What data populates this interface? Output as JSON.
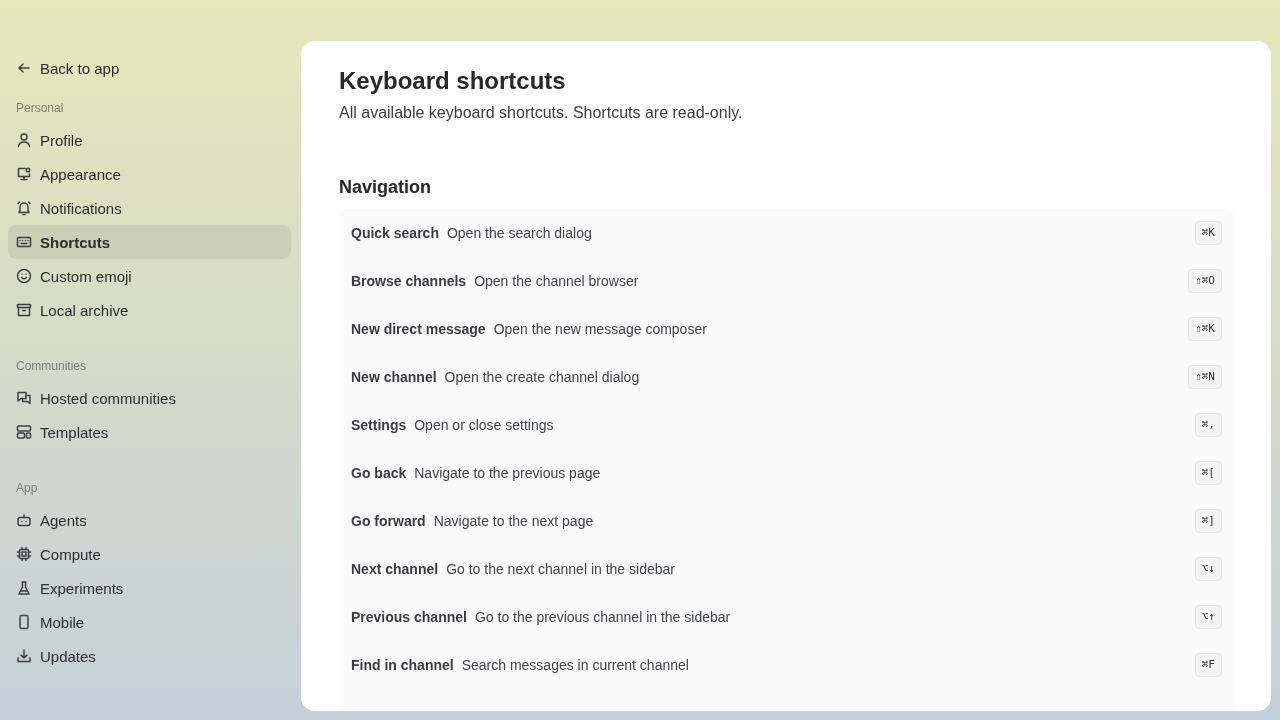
{
  "sidebar": {
    "back_link": "Back to app",
    "sections": [
      {
        "label": "Personal",
        "items": [
          {
            "label": "Profile",
            "selected": false
          },
          {
            "label": "Appearance",
            "selected": false
          },
          {
            "label": "Notifications",
            "selected": false
          },
          {
            "label": "Shortcuts",
            "selected": true
          },
          {
            "label": "Custom emoji",
            "selected": false
          },
          {
            "label": "Local archive",
            "selected": false
          }
        ]
      },
      {
        "label": "Communities",
        "items": [
          {
            "label": "Hosted communities",
            "selected": false
          },
          {
            "label": "Templates",
            "selected": false
          }
        ]
      },
      {
        "label": "App",
        "items": [
          {
            "label": "Agents",
            "selected": false
          },
          {
            "label": "Compute",
            "selected": false
          },
          {
            "label": "Experiments",
            "selected": false
          },
          {
            "label": "Mobile",
            "selected": false
          },
          {
            "label": "Updates",
            "selected": false
          }
        ]
      }
    ]
  },
  "page": {
    "title": "Keyboard shortcuts",
    "subtitle": "All available keyboard shortcuts. Shortcuts are read-only.",
    "groups": [
      {
        "heading": "Navigation",
        "shortcuts": [
          {
            "name": "Quick search",
            "description": "Open the search dialog",
            "keys": "⌘K"
          },
          {
            "name": "Browse channels",
            "description": "Open the channel browser",
            "keys": "⇧⌘O"
          },
          {
            "name": "New direct message",
            "description": "Open the new message composer",
            "keys": "⇧⌘K"
          },
          {
            "name": "New channel",
            "description": "Open the create channel dialog",
            "keys": "⇧⌘N"
          },
          {
            "name": "Settings",
            "description": "Open or close settings",
            "keys": "⌘,"
          },
          {
            "name": "Go back",
            "description": "Navigate to the previous page",
            "keys": "⌘["
          },
          {
            "name": "Go forward",
            "description": "Navigate to the next page",
            "keys": "⌘]"
          },
          {
            "name": "Next channel",
            "description": "Go to the next channel in the sidebar",
            "keys": "⌥↓"
          },
          {
            "name": "Previous channel",
            "description": "Go to the previous channel in the sidebar",
            "keys": "⌥↑"
          },
          {
            "name": "Find in channel",
            "description": "Search messages in current channel",
            "keys": "⌘F"
          }
        ]
      }
    ]
  }
}
